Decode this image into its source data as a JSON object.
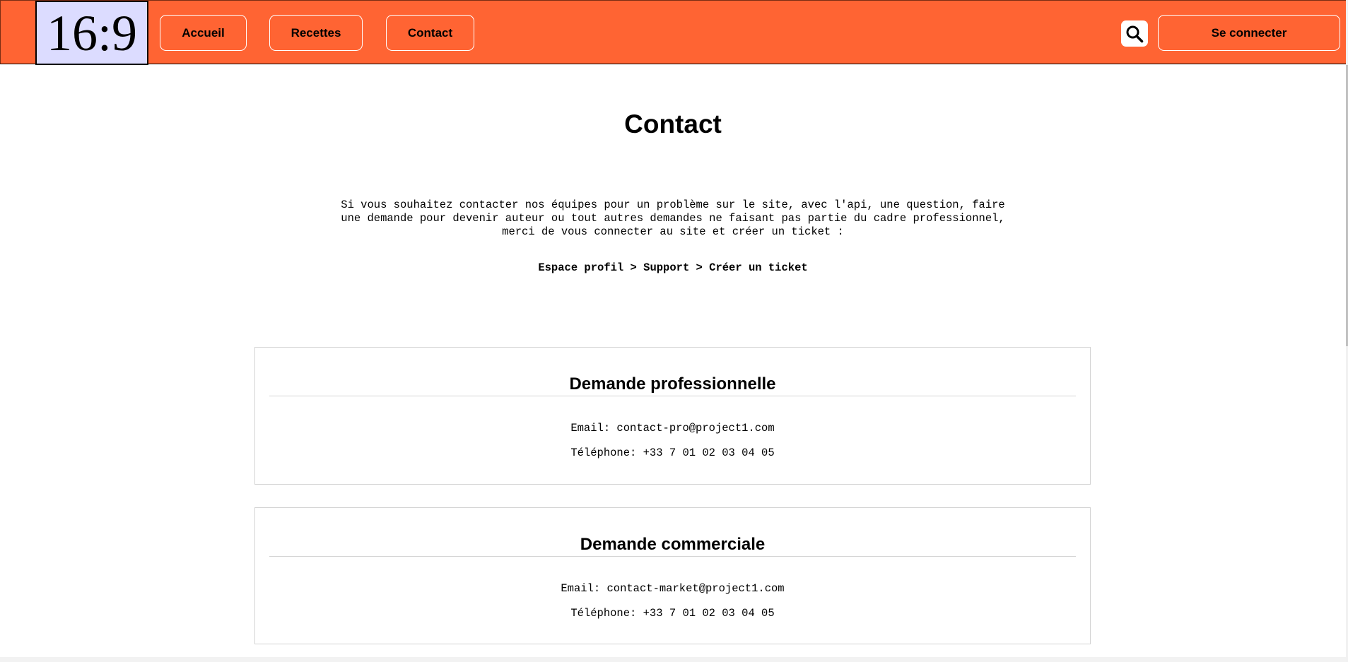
{
  "header": {
    "logo_text": "16:9",
    "nav": {
      "accueil": "Accueil",
      "recettes": "Recettes",
      "contact": "Contact"
    },
    "search_icon": "search-icon",
    "login_label": "Se connecter",
    "accent_color": "#ff6433"
  },
  "main": {
    "title": "Contact",
    "intro": "Si vous souhaitez contacter nos équipes pour un problème sur le site, avec l'api, une question, faire une demande pour devenir auteur ou tout autres demandes ne faisant pas partie du cadre professionnel, merci de vous connecter au site et créer un ticket :",
    "path": "Espace profil > Support > Créer un ticket",
    "cards": [
      {
        "title": "Demande professionnelle",
        "email": "Email: contact-pro@project1.com",
        "phone": "Téléphone: +33 7 01 02 03 04 05"
      },
      {
        "title": "Demande commerciale",
        "email": "Email: contact-market@project1.com",
        "phone": "Téléphone: +33 7 01 02 03 04 05"
      }
    ]
  }
}
